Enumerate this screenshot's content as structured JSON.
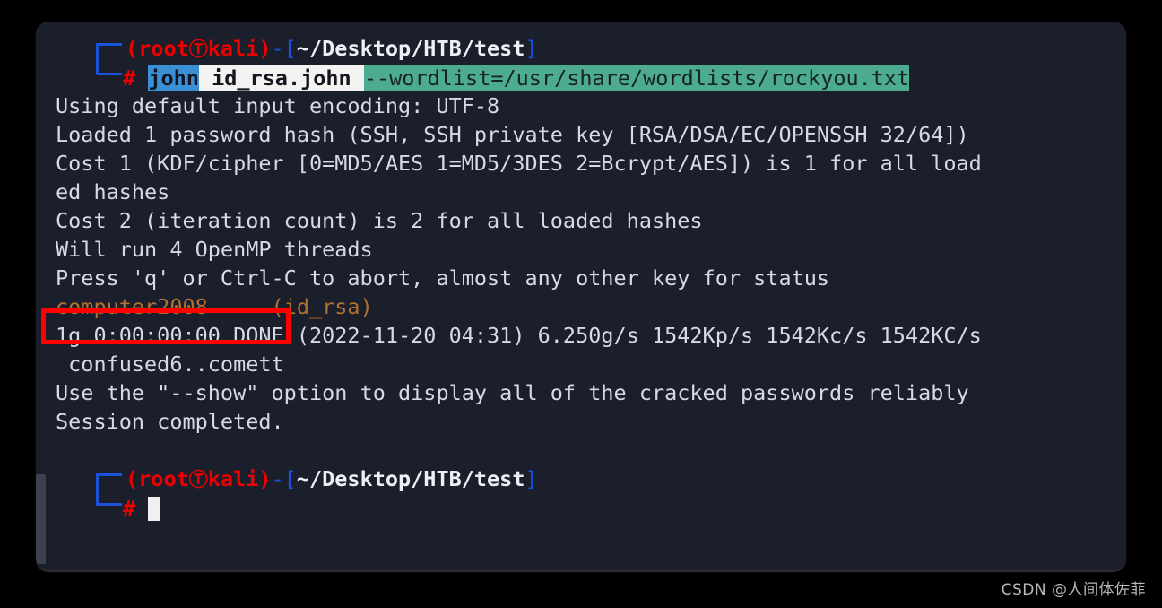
{
  "window": {
    "background_color": "#1b1e2b",
    "page_background_color": "#000000"
  },
  "prompt_top": {
    "open_paren": "(",
    "user": "root",
    "glyph": "kali-dragon-icon",
    "host": "kali",
    "close_paren": ")",
    "dash": "-",
    "bracket_open": "[",
    "path": "~/Desktop/HTB/test",
    "bracket_close": "]",
    "hash": "#"
  },
  "command": {
    "program": "john",
    "argument": "id_rsa.john",
    "option": "--wordlist=/usr/share/wordlists/rockyou.txt",
    "full": "john id_rsa.john --wordlist=/usr/share/wordlists/rockyou.txt"
  },
  "output_lines": [
    "Using default input encoding: UTF-8",
    "Loaded 1 password hash (SSH, SSH private key [RSA/DSA/EC/OPENSSH 32/64])",
    "Cost 1 (KDF/cipher [0=MD5/AES 1=MD5/3DES 2=Bcrypt/AES]) is 1 for all load",
    "ed hashes",
    "Cost 2 (iteration count) is 2 for all loaded hashes",
    "Will run 4 OpenMP threads",
    "Press 'q' or Ctrl-C to abort, almost any other key for status"
  ],
  "cracked": {
    "password": "computer2008",
    "keyname": "(id_rsa)",
    "highlight_color": "#fe0000"
  },
  "stats_line": "1g 0:00:00:00 DONE (2022-11-20 04:31) 6.250g/s 1542Kp/s 1542Kc/s 1542KC/s",
  "candidates_line": " confused6..comett",
  "footer_lines": [
    "Use the \"--show\" option to display all of the cracked passwords reliably",
    "Session completed."
  ],
  "prompt_bottom": {
    "open_paren": "(",
    "user": "root",
    "glyph": "kali-dragon-icon",
    "host": "kali",
    "close_paren": ")",
    "dash": "-",
    "bracket_open": "[",
    "path": "~/Desktop/HTB/test",
    "bracket_close": "]",
    "hash": "#"
  },
  "watermark": "CSDN @人间体佐菲"
}
